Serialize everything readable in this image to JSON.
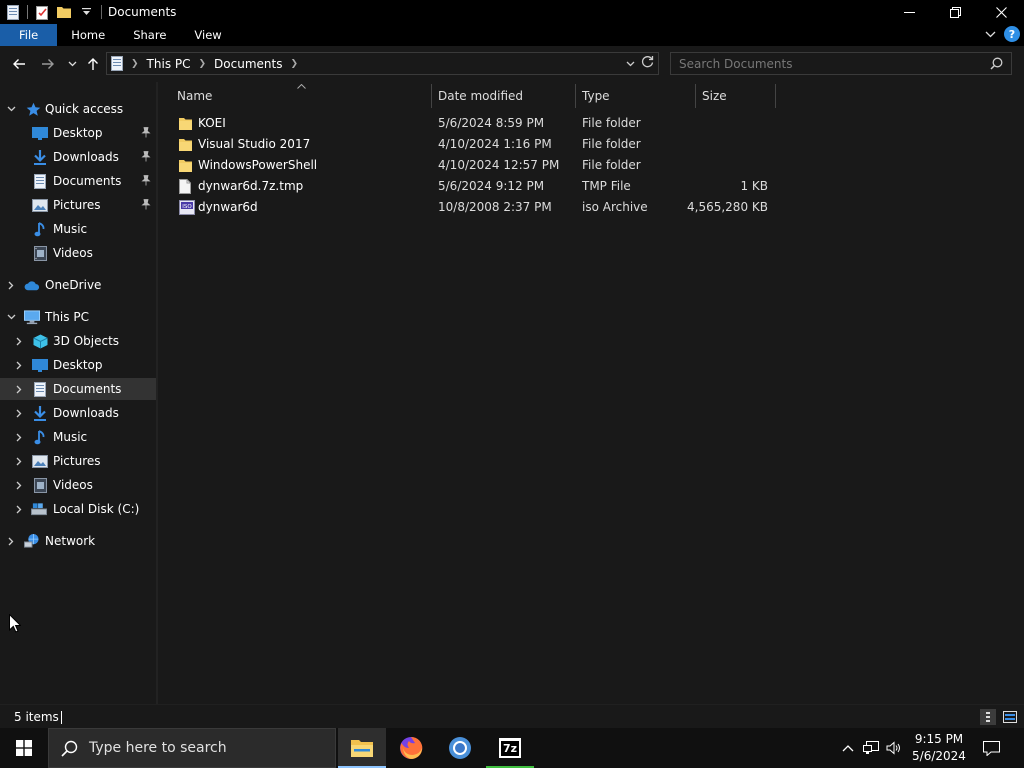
{
  "window": {
    "title": "Documents",
    "controls": {
      "minimize": "—",
      "maximize": "❐",
      "close": "✕"
    }
  },
  "ribbon": {
    "tabs": [
      "File",
      "Home",
      "Share",
      "View"
    ]
  },
  "address": {
    "crumbs": [
      "This PC",
      "Documents"
    ],
    "search_placeholder": "Search Documents"
  },
  "navpane": {
    "quick_access": "Quick access",
    "quick_items": [
      "Desktop",
      "Downloads",
      "Documents",
      "Pictures",
      "Music",
      "Videos"
    ],
    "onedrive": "OneDrive",
    "this_pc": "This PC",
    "pc_items": [
      "3D Objects",
      "Desktop",
      "Documents",
      "Downloads",
      "Music",
      "Pictures",
      "Videos",
      "Local Disk (C:)"
    ],
    "network": "Network"
  },
  "filelist": {
    "columns": {
      "name": "Name",
      "date": "Date modified",
      "type": "Type",
      "size": "Size"
    },
    "rows": [
      {
        "name": "KOEI",
        "date": "5/6/2024 8:59 PM",
        "type": "File folder",
        "size": "",
        "icon": "folder-icon"
      },
      {
        "name": "Visual Studio 2017",
        "date": "4/10/2024 1:16 PM",
        "type": "File folder",
        "size": "",
        "icon": "folder-icon"
      },
      {
        "name": "WindowsPowerShell",
        "date": "4/10/2024 12:57 PM",
        "type": "File folder",
        "size": "",
        "icon": "folder-icon"
      },
      {
        "name": "dynwar6d.7z.tmp",
        "date": "5/6/2024 9:12 PM",
        "type": "TMP File",
        "size": "1 KB",
        "icon": "file-icon"
      },
      {
        "name": "dynwar6d",
        "date": "10/8/2008 2:37 PM",
        "type": "iso Archive",
        "size": "4,565,280 KB",
        "icon": "iso-file-icon"
      }
    ]
  },
  "status": {
    "items_count": "5 items"
  },
  "taskbar": {
    "search_placeholder": "Type here to search",
    "apps": [
      "file-explorer-icon",
      "firefox-icon",
      "chrome-icon",
      "7zip-icon"
    ],
    "seven_zip_label": "7z",
    "clock_time": "9:15 PM",
    "clock_date": "5/6/2024"
  },
  "colors": {
    "accent": "#1a5ea8",
    "folder": "#f2cc62",
    "background": "#191919"
  }
}
